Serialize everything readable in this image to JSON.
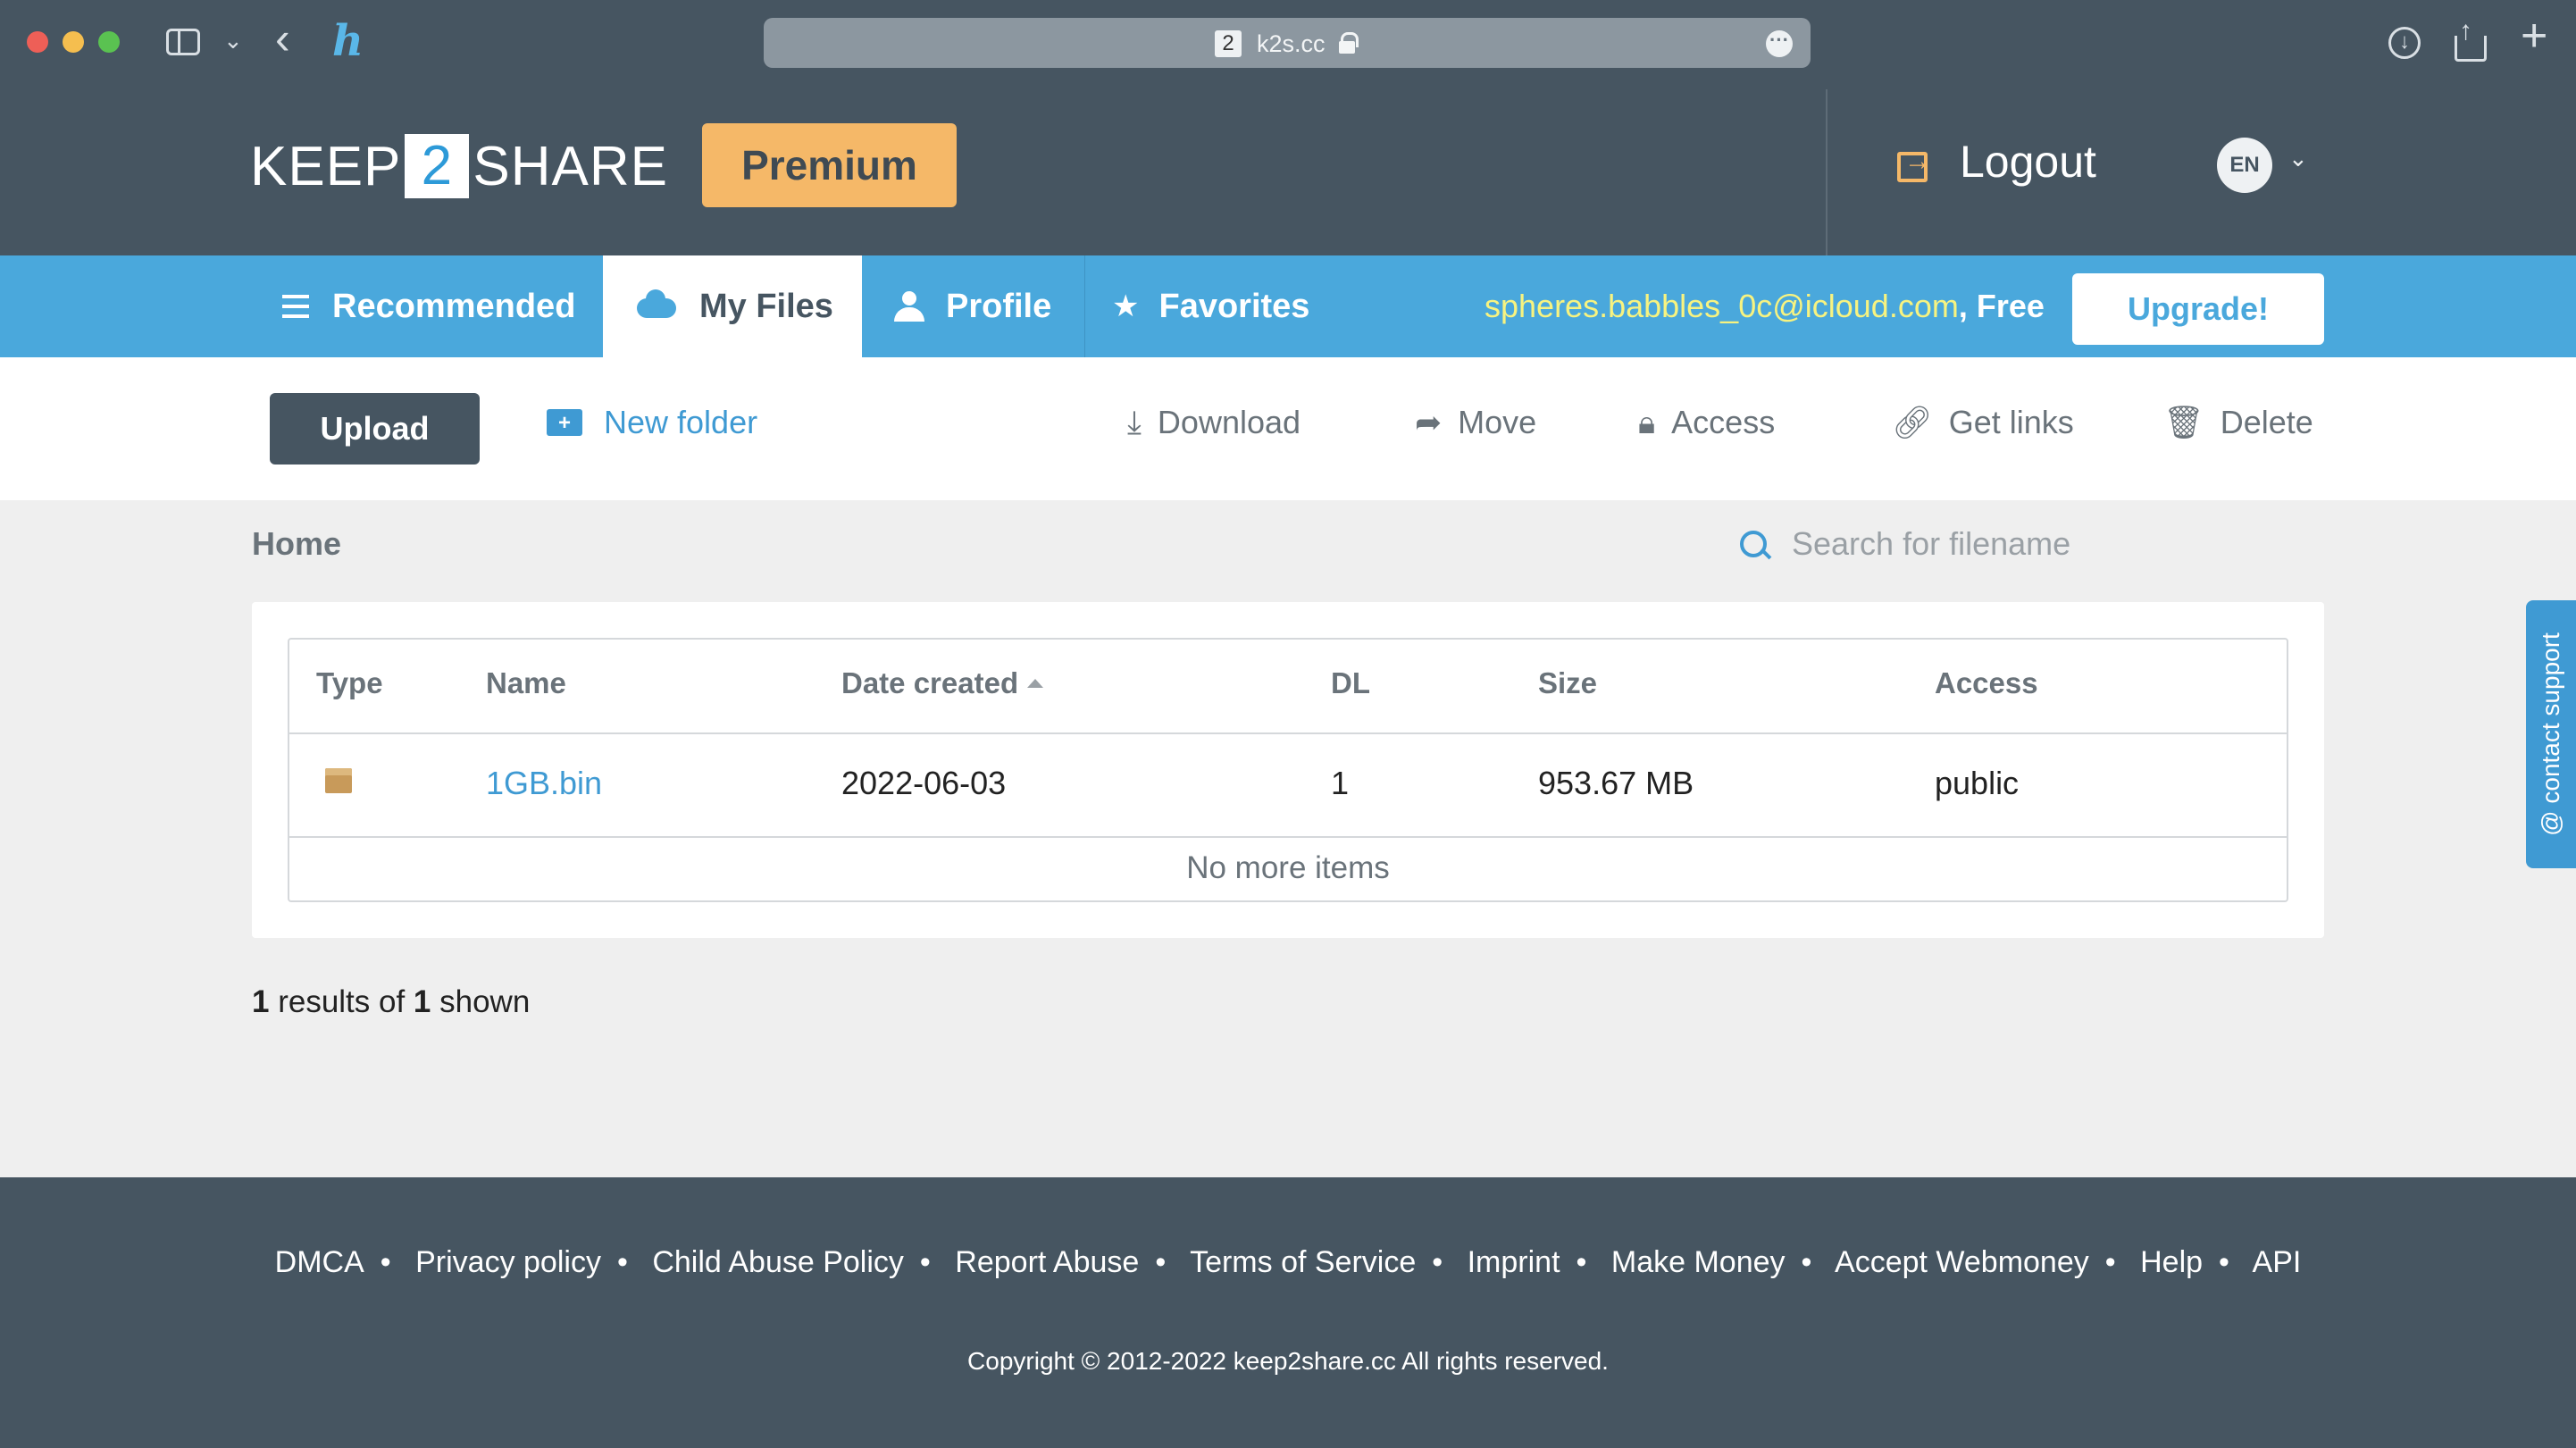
{
  "browser": {
    "favicon_text": "2",
    "url": "k2s.cc",
    "icons": [
      "sidebar-icon",
      "chevron-down-icon",
      "back-icon",
      "extension-icon",
      "lock-icon",
      "more-icon",
      "download-icon",
      "share-icon",
      "plus-icon"
    ]
  },
  "header": {
    "logo_left": "KEEP",
    "logo_num": "2",
    "logo_right": "SHARE",
    "premium_label": "Premium",
    "logout_label": "Logout",
    "language": "EN"
  },
  "nav": {
    "tabs": [
      {
        "label": "Recommended",
        "icon": "list-icon",
        "active": false
      },
      {
        "label": "My Files",
        "icon": "cloud-icon",
        "active": true
      },
      {
        "label": "Profile",
        "icon": "user-icon",
        "active": false
      },
      {
        "label": "Favorites",
        "icon": "star-icon",
        "active": false
      }
    ],
    "email": "spheres.babbles_0c@icloud.com",
    "separator": ", ",
    "plan": "Free",
    "upgrade_label": "Upgrade!"
  },
  "toolbar": {
    "upload_label": "Upload",
    "new_folder_label": "New folder",
    "download_label": "Download",
    "move_label": "Move",
    "access_label": "Access",
    "get_links_label": "Get links",
    "delete_label": "Delete"
  },
  "breadcrumb": "Home",
  "search": {
    "placeholder": "Search for filename"
  },
  "table": {
    "columns": [
      "Type",
      "Name",
      "Date created",
      "DL",
      "Size",
      "Access"
    ],
    "rows": [
      {
        "type_icon": "package-icon",
        "name": "1GB.bin",
        "date": "2022-06-03",
        "dl": "1",
        "size": "953.67 MB",
        "access": "public"
      }
    ],
    "no_more_label": "No more items"
  },
  "results": {
    "count": "1",
    "middle": " results of ",
    "total": "1",
    "suffix": " shown"
  },
  "support_label": "@ contact support",
  "footer": {
    "links": [
      "DMCA",
      "Privacy policy",
      "Child Abuse Policy",
      "Report Abuse",
      "Terms of Service",
      "Imprint",
      "Make Money",
      "Accept Webmoney",
      "Help",
      "API"
    ],
    "separator": "•",
    "copyright": "Copyright © 2012-2022 keep2share.cc All rights reserved."
  },
  "colors": {
    "header_bg": "#465561",
    "nav_bg": "#4aa8dc",
    "premium": "#f5b868",
    "link": "#3f9ad3",
    "email": "#f7f380"
  }
}
